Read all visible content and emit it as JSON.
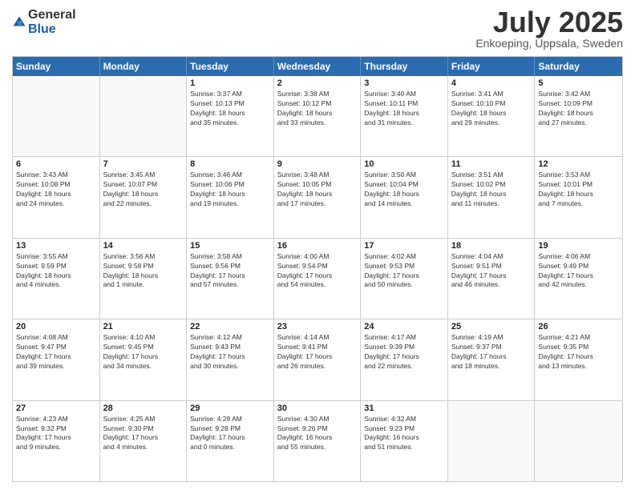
{
  "header": {
    "logo_general": "General",
    "logo_blue": "Blue",
    "title": "July 2025",
    "location": "Enkoeping, Uppsala, Sweden"
  },
  "days_of_week": [
    "Sunday",
    "Monday",
    "Tuesday",
    "Wednesday",
    "Thursday",
    "Friday",
    "Saturday"
  ],
  "weeks": [
    [
      {
        "day": "",
        "text": ""
      },
      {
        "day": "",
        "text": ""
      },
      {
        "day": "1",
        "text": "Sunrise: 3:37 AM\nSunset: 10:13 PM\nDaylight: 18 hours\nand 35 minutes."
      },
      {
        "day": "2",
        "text": "Sunrise: 3:38 AM\nSunset: 10:12 PM\nDaylight: 18 hours\nand 33 minutes."
      },
      {
        "day": "3",
        "text": "Sunrise: 3:40 AM\nSunset: 10:11 PM\nDaylight: 18 hours\nand 31 minutes."
      },
      {
        "day": "4",
        "text": "Sunrise: 3:41 AM\nSunset: 10:10 PM\nDaylight: 18 hours\nand 29 minutes."
      },
      {
        "day": "5",
        "text": "Sunrise: 3:42 AM\nSunset: 10:09 PM\nDaylight: 18 hours\nand 27 minutes."
      }
    ],
    [
      {
        "day": "6",
        "text": "Sunrise: 3:43 AM\nSunset: 10:08 PM\nDaylight: 18 hours\nand 24 minutes."
      },
      {
        "day": "7",
        "text": "Sunrise: 3:45 AM\nSunset: 10:07 PM\nDaylight: 18 hours\nand 22 minutes."
      },
      {
        "day": "8",
        "text": "Sunrise: 3:46 AM\nSunset: 10:06 PM\nDaylight: 18 hours\nand 19 minutes."
      },
      {
        "day": "9",
        "text": "Sunrise: 3:48 AM\nSunset: 10:05 PM\nDaylight: 18 hours\nand 17 minutes."
      },
      {
        "day": "10",
        "text": "Sunrise: 3:50 AM\nSunset: 10:04 PM\nDaylight: 18 hours\nand 14 minutes."
      },
      {
        "day": "11",
        "text": "Sunrise: 3:51 AM\nSunset: 10:02 PM\nDaylight: 18 hours\nand 11 minutes."
      },
      {
        "day": "12",
        "text": "Sunrise: 3:53 AM\nSunset: 10:01 PM\nDaylight: 18 hours\nand 7 minutes."
      }
    ],
    [
      {
        "day": "13",
        "text": "Sunrise: 3:55 AM\nSunset: 9:59 PM\nDaylight: 18 hours\nand 4 minutes."
      },
      {
        "day": "14",
        "text": "Sunrise: 3:56 AM\nSunset: 9:58 PM\nDaylight: 18 hours\nand 1 minute."
      },
      {
        "day": "15",
        "text": "Sunrise: 3:58 AM\nSunset: 9:56 PM\nDaylight: 17 hours\nand 57 minutes."
      },
      {
        "day": "16",
        "text": "Sunrise: 4:00 AM\nSunset: 9:54 PM\nDaylight: 17 hours\nand 54 minutes."
      },
      {
        "day": "17",
        "text": "Sunrise: 4:02 AM\nSunset: 9:53 PM\nDaylight: 17 hours\nand 50 minutes."
      },
      {
        "day": "18",
        "text": "Sunrise: 4:04 AM\nSunset: 9:51 PM\nDaylight: 17 hours\nand 46 minutes."
      },
      {
        "day": "19",
        "text": "Sunrise: 4:06 AM\nSunset: 9:49 PM\nDaylight: 17 hours\nand 42 minutes."
      }
    ],
    [
      {
        "day": "20",
        "text": "Sunrise: 4:08 AM\nSunset: 9:47 PM\nDaylight: 17 hours\nand 39 minutes."
      },
      {
        "day": "21",
        "text": "Sunrise: 4:10 AM\nSunset: 9:45 PM\nDaylight: 17 hours\nand 34 minutes."
      },
      {
        "day": "22",
        "text": "Sunrise: 4:12 AM\nSunset: 9:43 PM\nDaylight: 17 hours\nand 30 minutes."
      },
      {
        "day": "23",
        "text": "Sunrise: 4:14 AM\nSunset: 9:41 PM\nDaylight: 17 hours\nand 26 minutes."
      },
      {
        "day": "24",
        "text": "Sunrise: 4:17 AM\nSunset: 9:39 PM\nDaylight: 17 hours\nand 22 minutes."
      },
      {
        "day": "25",
        "text": "Sunrise: 4:19 AM\nSunset: 9:37 PM\nDaylight: 17 hours\nand 18 minutes."
      },
      {
        "day": "26",
        "text": "Sunrise: 4:21 AM\nSunset: 9:35 PM\nDaylight: 17 hours\nand 13 minutes."
      }
    ],
    [
      {
        "day": "27",
        "text": "Sunrise: 4:23 AM\nSunset: 9:32 PM\nDaylight: 17 hours\nand 9 minutes."
      },
      {
        "day": "28",
        "text": "Sunrise: 4:25 AM\nSunset: 9:30 PM\nDaylight: 17 hours\nand 4 minutes."
      },
      {
        "day": "29",
        "text": "Sunrise: 4:28 AM\nSunset: 9:28 PM\nDaylight: 17 hours\nand 0 minutes."
      },
      {
        "day": "30",
        "text": "Sunrise: 4:30 AM\nSunset: 9:26 PM\nDaylight: 16 hours\nand 55 minutes."
      },
      {
        "day": "31",
        "text": "Sunrise: 4:32 AM\nSunset: 9:23 PM\nDaylight: 16 hours\nand 51 minutes."
      },
      {
        "day": "",
        "text": ""
      },
      {
        "day": "",
        "text": ""
      }
    ]
  ]
}
